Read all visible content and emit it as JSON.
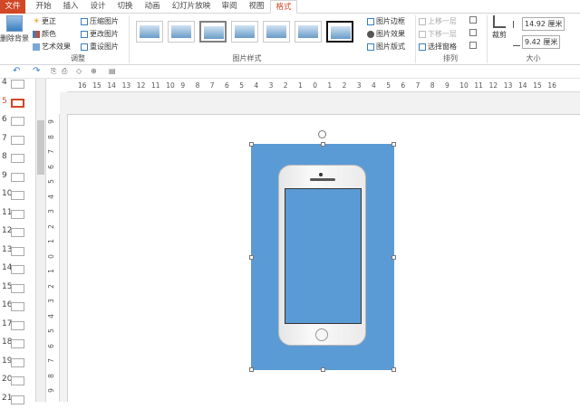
{
  "tabs": [
    "文件",
    "开始",
    "插入",
    "设计",
    "切换",
    "动画",
    "幻灯片放映",
    "审阅",
    "视图",
    "格式"
  ],
  "ribbon": {
    "remove_bg": "删除背景",
    "adjust": {
      "corrections": "更正",
      "color": "颜色",
      "artistic": "艺术效果",
      "compress": "压缩图片",
      "change": "更改图片",
      "reset": "重设图片",
      "label": "调整"
    },
    "styles_label": "图片样式",
    "style_menu": {
      "border": "图片边框",
      "effects": "图片效果",
      "layout": "图片版式"
    },
    "arrange": {
      "forward": "上移一层",
      "backward": "下移一层",
      "pane": "选择窗格",
      "label": "排列"
    },
    "crop": "裁剪",
    "size": {
      "height": "14.92 厘米",
      "width": "9.42 厘米",
      "label": "大小"
    }
  },
  "hruler": [
    "16",
    "15",
    "14",
    "13",
    "12",
    "11",
    "10",
    "9",
    "8",
    "7",
    "6",
    "5",
    "4",
    "3",
    "2",
    "1",
    "0",
    "1",
    "2",
    "3",
    "4",
    "5",
    "6",
    "7",
    "8",
    "9",
    "10",
    "11",
    "12",
    "13",
    "14",
    "15",
    "16"
  ],
  "vruler": [
    "9",
    "8",
    "7",
    "6",
    "5",
    "4",
    "3",
    "2",
    "1",
    "0",
    "1",
    "2",
    "3",
    "4",
    "5",
    "6",
    "7",
    "8",
    "9"
  ],
  "slides": [
    "4",
    "5",
    "6",
    "7",
    "8",
    "9",
    "10",
    "11",
    "12",
    "13",
    "14",
    "15",
    "16",
    "17",
    "18",
    "19",
    "20",
    "21"
  ],
  "colors": {
    "accent": "#d24726",
    "picture_bg": "#5b9bd5"
  }
}
